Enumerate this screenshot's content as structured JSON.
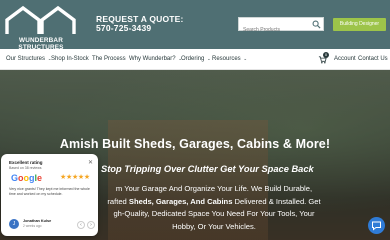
{
  "header": {
    "logo_text": "WUNDERBAR STRUCTURES",
    "quote_label": "REQUEST A QUOTE:",
    "phone": "570-725-3439",
    "search_placeholder": "Search Products",
    "build_button": "Building Designer",
    "colors": {
      "header_bg": "#4f6f73",
      "build_button": "#9dc44a"
    }
  },
  "nav": {
    "items": [
      {
        "label": "Our Structures",
        "has_dropdown": true
      },
      {
        "label": "Shop In-Stock",
        "has_dropdown": false
      },
      {
        "label": "The Process",
        "has_dropdown": false
      },
      {
        "label": "Why Wunderbar?",
        "has_dropdown": true
      },
      {
        "label": "Ordering",
        "has_dropdown": true
      },
      {
        "label": "Resources",
        "has_dropdown": true
      }
    ],
    "cart_count": "0",
    "account": "Account",
    "contact": "Contact Us"
  },
  "hero": {
    "title": "Amish Built Sheds, Garages, Cabins & More!",
    "subtitle": "Stop Tripping Over Clutter Get Your Space Back",
    "body_1": "m Your Garage And Organize Your Life. We Build Durable,",
    "body_2a": "rafted ",
    "body_2b": "Sheds, Garages, And Cabins",
    "body_2c": " Delivered & Installed. Get",
    "body_3": "gh-Quality, Dedicated Space You Need For Your Tools, Your",
    "body_4": "Hobby, Or Your Vehicles."
  },
  "review_widget": {
    "rating_label": "Excellent rating",
    "based_on": "Based on 38 reviews",
    "google": "Google",
    "stars": "★★★★★",
    "review_text": "Very nice grants! They kept me informed the whole time and worked on my schedule.",
    "avatar_initial": "J",
    "author": "Jonathan Kulse",
    "ago": "2 weeks ago"
  },
  "icons": [
    "search-icon",
    "cart-icon",
    "chat-icon",
    "close-icon",
    "chevron-left-icon",
    "chevron-right-icon"
  ]
}
